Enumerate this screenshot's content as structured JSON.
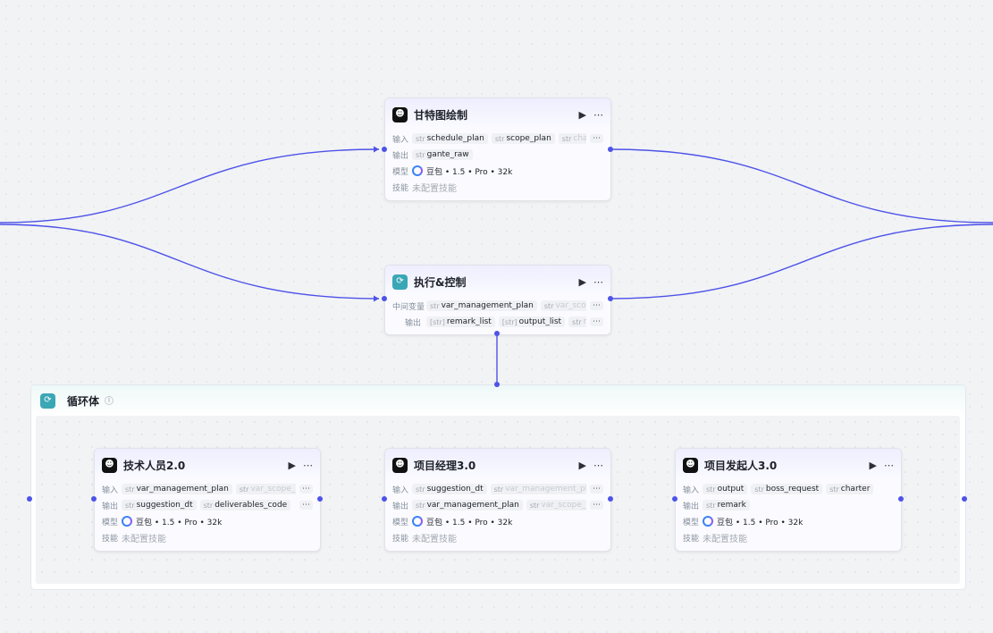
{
  "colors": {
    "edge": "#4d53e8",
    "loop_accent": "#3aa7b5",
    "node_bg": "#fbfbff"
  },
  "icons": {
    "node": "ghost-bot-icon",
    "loop": "loop-arrows-icon",
    "run": "play-icon",
    "more": "more-dots-icon",
    "model": "doubao-model-icon",
    "info": "info-icon"
  },
  "nodes": {
    "gantt": {
      "title": "甘特图绘制",
      "input_label": "输入",
      "inputs": [
        {
          "type": "str",
          "name": "schedule_plan"
        },
        {
          "type": "str",
          "name": "scope_plan"
        },
        {
          "type": "str",
          "name": "char"
        }
      ],
      "output_label": "输出",
      "outputs": [
        {
          "type": "str",
          "name": "gante_raw"
        }
      ],
      "model_label": "模型",
      "model": "豆包 • 1.5 • Pro • 32k",
      "skill_label": "技能",
      "skill": "未配置技能"
    },
    "exec": {
      "title": "执行&控制",
      "mid_label": "中间变量",
      "mids": [
        {
          "type": "str",
          "name": "var_management_plan"
        },
        {
          "type": "str",
          "name": "var_scop"
        }
      ],
      "output_label": "输出",
      "outputs": [
        {
          "type": "[str]",
          "name": "remark_list"
        },
        {
          "type": "[str]",
          "name": "output_list"
        },
        {
          "type": "str",
          "name": "ma"
        }
      ]
    },
    "tech": {
      "title": "技术人员2.0",
      "input_label": "输入",
      "inputs": [
        {
          "type": "str",
          "name": "var_management_plan"
        },
        {
          "type": "str",
          "name": "var_scope_p"
        }
      ],
      "output_label": "输出",
      "outputs": [
        {
          "type": "str",
          "name": "suggestion_dt"
        },
        {
          "type": "str",
          "name": "deliverables_code"
        }
      ],
      "model_label": "模型",
      "model": "豆包 • 1.5 • Pro • 32k",
      "skill_label": "技能",
      "skill": "未配置技能"
    },
    "pm": {
      "title": "项目经理3.0",
      "input_label": "输入",
      "inputs": [
        {
          "type": "str",
          "name": "suggestion_dt"
        },
        {
          "type": "str",
          "name": "var_management_pla"
        }
      ],
      "output_label": "输出",
      "outputs": [
        {
          "type": "str",
          "name": "var_management_plan"
        },
        {
          "type": "str",
          "name": "var_scope_p"
        }
      ],
      "model_label": "模型",
      "model": "豆包 • 1.5 • Pro • 32k",
      "skill_label": "技能",
      "skill": "未配置技能"
    },
    "sponsor": {
      "title": "项目发起人3.0",
      "input_label": "输入",
      "inputs": [
        {
          "type": "str",
          "name": "output"
        },
        {
          "type": "str",
          "name": "boss_request"
        },
        {
          "type": "str",
          "name": "charter"
        }
      ],
      "output_label": "输出",
      "outputs": [
        {
          "type": "str",
          "name": "remark"
        }
      ],
      "model_label": "模型",
      "model": "豆包 • 1.5 • Pro • 32k",
      "skill_label": "技能",
      "skill": "未配置技能"
    }
  },
  "loop": {
    "title": "循环体"
  },
  "glyphs": {
    "run": "▶",
    "more": "⋯",
    "ellipsis": "⋯",
    "info": "i"
  }
}
